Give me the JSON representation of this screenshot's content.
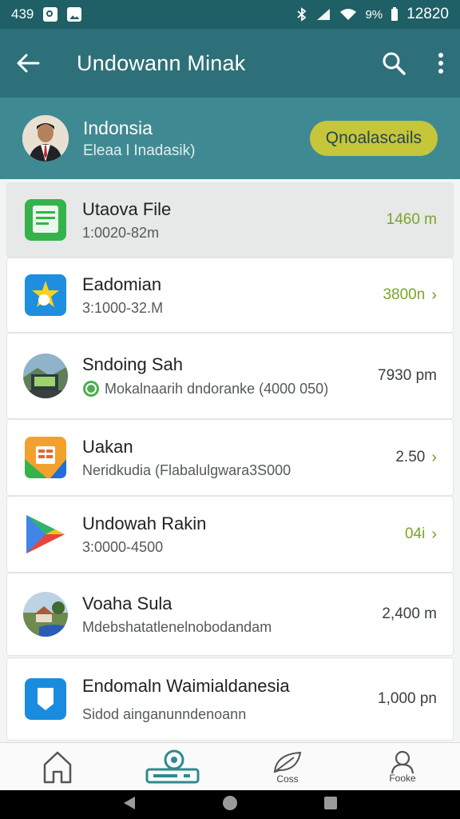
{
  "status_bar": {
    "time_left": "439",
    "battery": "9%",
    "clock": "12820"
  },
  "app_bar": {
    "title": "Undowann Minak",
    "back_icon": "arrow-left-icon",
    "search_icon": "search-icon",
    "more_icon": "more-vertical-icon"
  },
  "profile": {
    "name": "Indonsia",
    "subtitle": "Eleaa l Inadasik)",
    "action_label": "Qnoalascails"
  },
  "list": [
    {
      "name": "Utaova File",
      "sub": "1:0020-82m",
      "value": "1460 m",
      "value_color": "green",
      "chevron": false,
      "icon": "document-app-icon",
      "highlight": true
    },
    {
      "name": "Eadomian",
      "sub": "3:1000-32.M",
      "value": "3800n",
      "value_color": "green",
      "chevron": true,
      "icon": "star-app-icon",
      "highlight": false
    },
    {
      "name": "Sndoing Sah",
      "sub": "Mokalnaarih dndoranke (4000 050)",
      "value": "7930 pm",
      "value_color": "default",
      "chevron": false,
      "icon": "landscape-photo-icon",
      "highlight": false,
      "sub_icon": "whatsapp-icon"
    },
    {
      "name": "Uakan",
      "sub": "Neridkudia (Flabalulgwara3S000",
      "value": "2.50",
      "value_color": "default",
      "chevron": true,
      "icon": "spreadsheet-app-icon",
      "highlight": false
    },
    {
      "name": "Undowah Rakin",
      "sub": "3:0000-4500",
      "value": "04i",
      "value_color": "green",
      "chevron": true,
      "icon": "play-store-icon",
      "highlight": false
    },
    {
      "name": "Voaha Sula",
      "sub": "Mdebshatatlenelnobodandam",
      "value": "2,400 m",
      "value_color": "default",
      "chevron": false,
      "icon": "town-photo-icon",
      "highlight": false
    },
    {
      "name": "Endomaln Waimialdanesia",
      "sub": "Sidod ainganunndenoann",
      "value": "1,000 pn",
      "value_color": "default",
      "chevron": false,
      "icon": "shield-app-icon",
      "highlight": false
    }
  ],
  "bottom_nav": [
    {
      "icon": "home-icon",
      "label": ""
    },
    {
      "icon": "scanner-icon",
      "label": "",
      "active": true
    },
    {
      "icon": "leaf-icon",
      "label": "Coss"
    },
    {
      "icon": "person-icon",
      "label": "Fooke"
    }
  ],
  "colors": {
    "status_bar": "#1f5f66",
    "app_bar": "#2e7079",
    "profile_bg": "#3f8a92",
    "pill_bg": "#c6c63a",
    "accent_green": "#7aa429",
    "active_nav": "#2e8a8e"
  }
}
